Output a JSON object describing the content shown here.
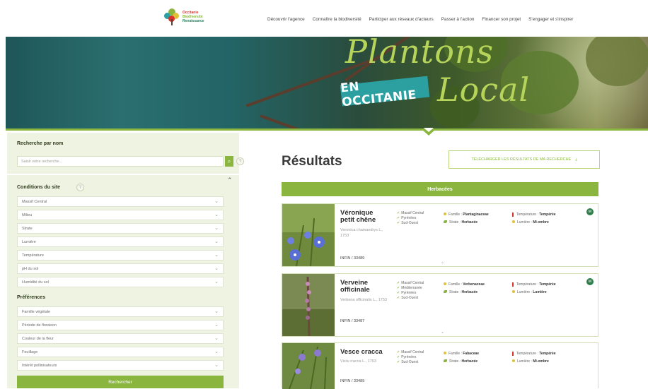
{
  "header": {
    "logo_lines": [
      "Occitanie",
      "Biodiversité",
      "Renaissance"
    ],
    "nav": [
      "Découvrir l'agence",
      "Connaître la biodiversité",
      "Participer aux réseaux d'acteurs",
      "Passer à l'action",
      "Financer son projet",
      "S'engager et s'inspirer"
    ]
  },
  "banner": {
    "script_word_1": "Plantons",
    "script_word_2": "Local",
    "badge": "EN OCCITANIE"
  },
  "sidebar": {
    "search_title": "Recherche par nom",
    "search_placeholder": "Saisir votre recherche...",
    "site_title": "Conditions du site",
    "site_filters": [
      "Massif Central",
      "Milieu",
      "Strate",
      "Lumière",
      "Température",
      "pH du sol",
      "Humidité du sol"
    ],
    "pref_title": "Préférences",
    "pref_filters": [
      "Famille végétale",
      "Période de floraison",
      "Couleur de la fleur",
      "Feuillage",
      "Intérêt pollinisateurs"
    ],
    "submit": "Rechercher"
  },
  "results": {
    "title": "Résultats",
    "download": "TÉLÉCHARGER LES RÉSULTATS DE MA RECHERCHE",
    "group": "Herbacées",
    "cards": [
      {
        "name": "Véronique petit chêne",
        "latin": "Veronica chamaedrys L., 1753",
        "code": "INFIN / 33489",
        "conditions": [
          "Massif Central",
          "Pyrénées",
          "Sud-Ouest"
        ],
        "famille_label": "Famille :",
        "famille": "Plantaginaceae",
        "strate_label": "Strate :",
        "strate": "Herbacée",
        "temp_label": "Température :",
        "temp": "Tempérée",
        "lum_label": "Lumière :",
        "lum": "Mi-ombre",
        "badge": "M"
      },
      {
        "name": "Verveine officinale",
        "latin": "Verbena officinalis L., 1753",
        "code": "INFIN / 33487",
        "conditions": [
          "Massif Central",
          "Méditerranée",
          "Pyrénées",
          "Sud-Ouest"
        ],
        "famille_label": "Famille :",
        "famille": "Verbenaceae",
        "strate_label": "Strate :",
        "strate": "Herbacée",
        "temp_label": "Température :",
        "temp": "Tempérée",
        "lum_label": "Lumière :",
        "lum": "Lumière",
        "badge": "M"
      },
      {
        "name": "Vesce cracca",
        "latin": "Vicia cracca L., 1753",
        "code": "INFIN / 33489",
        "conditions": [
          "Massif Central",
          "Pyrénées",
          "Sud-Ouest"
        ],
        "famille_label": "Famille :",
        "famille": "Fabaceae",
        "strate_label": "Strate :",
        "strate": "Herbacée",
        "temp_label": "Température :",
        "temp": "Tempérée",
        "lum_label": "Lumière :",
        "lum": "Mi-ombre"
      }
    ]
  },
  "colors": {
    "accent": "#8ab63f",
    "teal": "#2c9fa0",
    "sidebar_bg": "#eef3e2"
  }
}
